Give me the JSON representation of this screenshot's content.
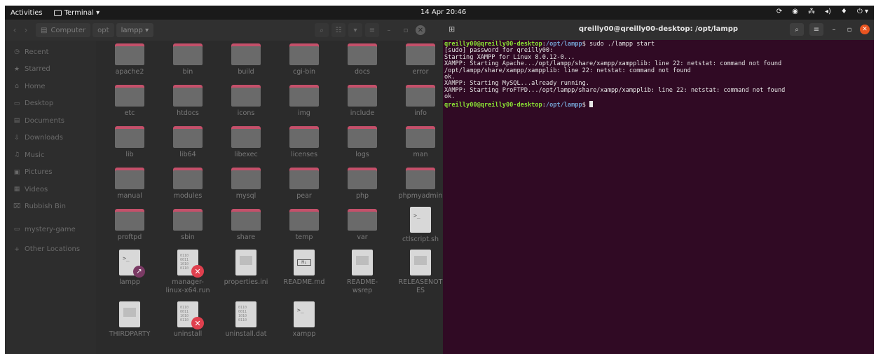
{
  "topbar": {
    "activities": "Activities",
    "app_name": "Terminal ▾",
    "clock": "14 Apr 20:46",
    "tray": [
      "⟳",
      "◉",
      "⁂",
      "◂)",
      "♦",
      "⏻ ▾"
    ]
  },
  "file_manager": {
    "path": [
      "Computer",
      "opt",
      "lampp ▾"
    ],
    "nav_back": "‹",
    "nav_forward": "›",
    "toolbar": {
      "search": "⌕",
      "view": "☷",
      "view_menu": "▾",
      "menu": "≡",
      "minimize": "–",
      "maximize": "▫",
      "close": "✕"
    },
    "sidebar": [
      {
        "label": "Recent",
        "icon": "◷",
        "icon_name": "clock-icon"
      },
      {
        "label": "Starred",
        "icon": "★",
        "icon_name": "star-icon"
      },
      {
        "label": "Home",
        "icon": "⌂",
        "icon_name": "home-icon"
      },
      {
        "label": "Desktop",
        "icon": "▭",
        "icon_name": "desktop-icon"
      },
      {
        "label": "Documents",
        "icon": "▤",
        "icon_name": "document-icon"
      },
      {
        "label": "Downloads",
        "icon": "⇩",
        "icon_name": "download-icon"
      },
      {
        "label": "Music",
        "icon": "♫",
        "icon_name": "music-icon"
      },
      {
        "label": "Pictures",
        "icon": "▣",
        "icon_name": "picture-icon"
      },
      {
        "label": "Videos",
        "icon": "▦",
        "icon_name": "video-icon"
      },
      {
        "label": "Rubbish Bin",
        "icon": "⌧",
        "icon_name": "trash-icon"
      },
      {
        "label": "mystery-game",
        "icon": "▭",
        "icon_name": "drive-icon"
      },
      {
        "label": "Other Locations",
        "icon": "+",
        "icon_name": "plus-icon"
      }
    ],
    "items": [
      {
        "name": "apache2",
        "kind": "folder"
      },
      {
        "name": "bin",
        "kind": "folder"
      },
      {
        "name": "build",
        "kind": "folder"
      },
      {
        "name": "cgi-bin",
        "kind": "folder"
      },
      {
        "name": "docs",
        "kind": "folder"
      },
      {
        "name": "error",
        "kind": "folder"
      },
      {
        "name": "etc",
        "kind": "folder"
      },
      {
        "name": "htdocs",
        "kind": "folder"
      },
      {
        "name": "icons",
        "kind": "folder"
      },
      {
        "name": "img",
        "kind": "folder"
      },
      {
        "name": "include",
        "kind": "folder"
      },
      {
        "name": "info",
        "kind": "folder"
      },
      {
        "name": "lib",
        "kind": "folder"
      },
      {
        "name": "lib64",
        "kind": "folder"
      },
      {
        "name": "libexec",
        "kind": "folder"
      },
      {
        "name": "licenses",
        "kind": "folder"
      },
      {
        "name": "logs",
        "kind": "folder"
      },
      {
        "name": "man",
        "kind": "folder"
      },
      {
        "name": "manual",
        "kind": "folder"
      },
      {
        "name": "modules",
        "kind": "folder"
      },
      {
        "name": "mysql",
        "kind": "folder"
      },
      {
        "name": "pear",
        "kind": "folder"
      },
      {
        "name": "php",
        "kind": "folder"
      },
      {
        "name": "phpmyadmin",
        "kind": "folder"
      },
      {
        "name": "proftpd",
        "kind": "folder"
      },
      {
        "name": "sbin",
        "kind": "folder"
      },
      {
        "name": "share",
        "kind": "folder"
      },
      {
        "name": "temp",
        "kind": "folder"
      },
      {
        "name": "var",
        "kind": "folder"
      },
      {
        "name": "ctlscript.sh",
        "kind": "script"
      },
      {
        "name": "lampp",
        "kind": "script-link"
      },
      {
        "name": "manager-\nlinux-x64.run",
        "kind": "binary-error"
      },
      {
        "name": "properties.ini",
        "kind": "text"
      },
      {
        "name": "README.md",
        "kind": "markdown"
      },
      {
        "name": "README-\nwsrep",
        "kind": "text"
      },
      {
        "name": "RELEASENOT\nES",
        "kind": "text"
      },
      {
        "name": "THIRDPARTY",
        "kind": "text"
      },
      {
        "name": "uninstall",
        "kind": "binary-error"
      },
      {
        "name": "uninstall.dat",
        "kind": "binary"
      },
      {
        "name": "xampp",
        "kind": "script"
      }
    ]
  },
  "terminal": {
    "title": "qreilly00@qreilly00-desktop: /opt/lampp",
    "new_tab": "⊞",
    "search": "⌕",
    "menu": "≡",
    "minimize": "–",
    "maximize": "▫",
    "close": "✕",
    "prompt_user": "qreilly00@qreilly00-desktop",
    "prompt_path": "/opt/lampp",
    "command": "$ sudo ./lampp start",
    "output": [
      "[sudo] password for qreilly00:",
      "Starting XAMPP for Linux 8.0.12-0...",
      "XAMPP: Starting Apache.../opt/lampp/share/xampp/xampplib: line 22: netstat: command not found",
      "/opt/lampp/share/xampp/xampplib: line 22: netstat: command not found",
      "ok.",
      "XAMPP: Starting MySQL...already running.",
      "XAMPP: Starting ProFTPD.../opt/lampp/share/xampp/xampplib: line 22: netstat: command not found",
      "ok."
    ],
    "final_prompt_suffix": "$ ",
    "colors": {
      "background": "#300a24",
      "user": "#8ae234",
      "path": "#729fcf",
      "text": "#e6e6e6"
    }
  }
}
